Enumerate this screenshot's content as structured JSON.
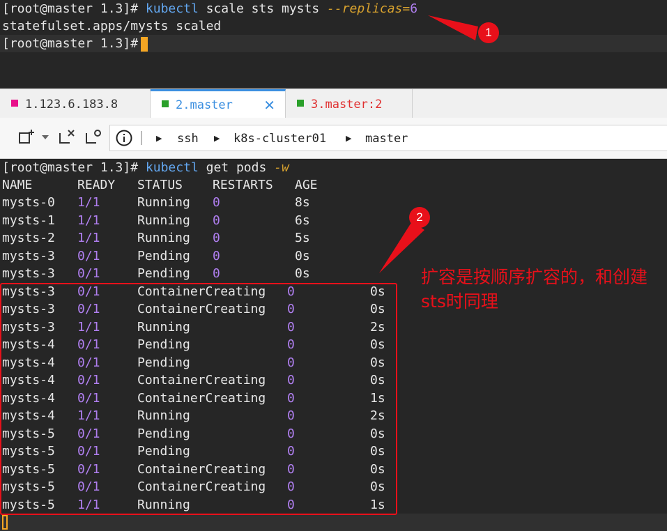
{
  "top_terminal": {
    "lines": [
      {
        "prompt": "[root@master 1.3]#",
        "cmd": "kubectl",
        "args": " scale sts mysts ",
        "opt": "--replicas",
        "eq": "=",
        "num": "6"
      },
      {
        "text": "statefulset.apps/mysts scaled"
      },
      {
        "prompt": "[root@master 1.3]#"
      }
    ]
  },
  "tabs": [
    {
      "label": "1.123.6.183.8",
      "color": "#e8108a"
    },
    {
      "label": "2.master",
      "color": "#2aa02a"
    },
    {
      "label": "3.master:2",
      "color": "#2aa02a"
    }
  ],
  "toolbar": {
    "crumbs": [
      "ssh",
      "k8s-cluster01",
      "master"
    ]
  },
  "bottom_terminal": {
    "prompt": "[root@master 1.3]#",
    "cmd": "kubectl",
    "args": " get pods ",
    "opt": "-w",
    "header": [
      "NAME",
      "READY",
      "STATUS",
      "RESTARTS",
      "AGE"
    ],
    "rows_a": [
      [
        "mysts-0",
        "1/1",
        "Running",
        "0",
        "8s"
      ],
      [
        "mysts-1",
        "1/1",
        "Running",
        "0",
        "6s"
      ],
      [
        "mysts-2",
        "1/1",
        "Running",
        "0",
        "5s"
      ],
      [
        "mysts-3",
        "0/1",
        "Pending",
        "0",
        "0s"
      ],
      [
        "mysts-3",
        "0/1",
        "Pending",
        "0",
        "0s"
      ]
    ],
    "rows_b": [
      [
        "mysts-3",
        "0/1",
        "ContainerCreating",
        "0",
        "0s"
      ],
      [
        "mysts-3",
        "0/1",
        "ContainerCreating",
        "0",
        "0s"
      ],
      [
        "mysts-3",
        "1/1",
        "Running",
        "0",
        "2s"
      ],
      [
        "mysts-4",
        "0/1",
        "Pending",
        "0",
        "0s"
      ],
      [
        "mysts-4",
        "0/1",
        "Pending",
        "0",
        "0s"
      ],
      [
        "mysts-4",
        "0/1",
        "ContainerCreating",
        "0",
        "0s"
      ],
      [
        "mysts-4",
        "0/1",
        "ContainerCreating",
        "0",
        "1s"
      ],
      [
        "mysts-4",
        "1/1",
        "Running",
        "0",
        "2s"
      ],
      [
        "mysts-5",
        "0/1",
        "Pending",
        "0",
        "0s"
      ],
      [
        "mysts-5",
        "0/1",
        "Pending",
        "0",
        "0s"
      ],
      [
        "mysts-5",
        "0/1",
        "ContainerCreating",
        "0",
        "0s"
      ],
      [
        "mysts-5",
        "0/1",
        "ContainerCreating",
        "0",
        "0s"
      ],
      [
        "mysts-5",
        "1/1",
        "Running",
        "0",
        "1s"
      ]
    ]
  },
  "annotations": {
    "badge1": "1",
    "badge2": "2",
    "note": "扩容是按顺序扩容的，和创建sts时同理"
  }
}
